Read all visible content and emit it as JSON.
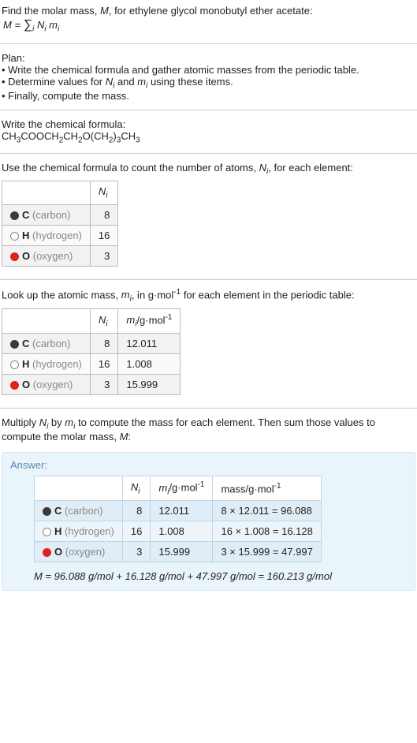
{
  "intro": {
    "line1": "Find the molar mass, M, for ethylene glycol monobutyl ether acetate:",
    "sum_formula_html": "M = ∑_i N_i m_i"
  },
  "plan": {
    "heading": "Plan:",
    "items": [
      "Write the chemical formula and gather atomic masses from the periodic table.",
      "Determine values for N_i and m_i using these items.",
      "Finally, compute the mass."
    ]
  },
  "formula": {
    "heading": "Write the chemical formula:",
    "chem": "CH3COOCH2CH2O(CH2)3CH3"
  },
  "count": {
    "heading": "Use the chemical formula to count the number of atoms, N_i, for each element:",
    "header_N": "N_i",
    "rows": [
      {
        "symbol": "C",
        "name": "(carbon)",
        "dot": "dot-c",
        "N": "8"
      },
      {
        "symbol": "H",
        "name": "(hydrogen)",
        "dot": "dot-h",
        "N": "16"
      },
      {
        "symbol": "O",
        "name": "(oxygen)",
        "dot": "dot-o",
        "N": "3"
      }
    ]
  },
  "masses": {
    "heading": "Look up the atomic mass, m_i, in g·mol^-1 for each element in the periodic table:",
    "header_N": "N_i",
    "header_m": "m_i/g·mol^-1",
    "rows": [
      {
        "symbol": "C",
        "name": "(carbon)",
        "dot": "dot-c",
        "N": "8",
        "m": "12.011"
      },
      {
        "symbol": "H",
        "name": "(hydrogen)",
        "dot": "dot-h",
        "N": "16",
        "m": "1.008"
      },
      {
        "symbol": "O",
        "name": "(oxygen)",
        "dot": "dot-o",
        "N": "3",
        "m": "15.999"
      }
    ]
  },
  "instruction": "Multiply N_i by m_i to compute the mass for each element. Then sum those values to compute the molar mass, M:",
  "answer": {
    "label": "Answer:",
    "header_N": "N_i",
    "header_m": "m_i/g·mol^-1",
    "header_mass": "mass/g·mol^-1",
    "rows": [
      {
        "symbol": "C",
        "name": "(carbon)",
        "dot": "dot-c",
        "N": "8",
        "m": "12.011",
        "mass": "8 × 12.011 = 96.088"
      },
      {
        "symbol": "H",
        "name": "(hydrogen)",
        "dot": "dot-h",
        "N": "16",
        "m": "1.008",
        "mass": "16 × 1.008 = 16.128"
      },
      {
        "symbol": "O",
        "name": "(oxygen)",
        "dot": "dot-o",
        "N": "3",
        "m": "15.999",
        "mass": "3 × 15.999 = 47.997"
      }
    ],
    "final": "M = 96.088 g/mol + 16.128 g/mol + 47.997 g/mol = 160.213 g/mol"
  }
}
